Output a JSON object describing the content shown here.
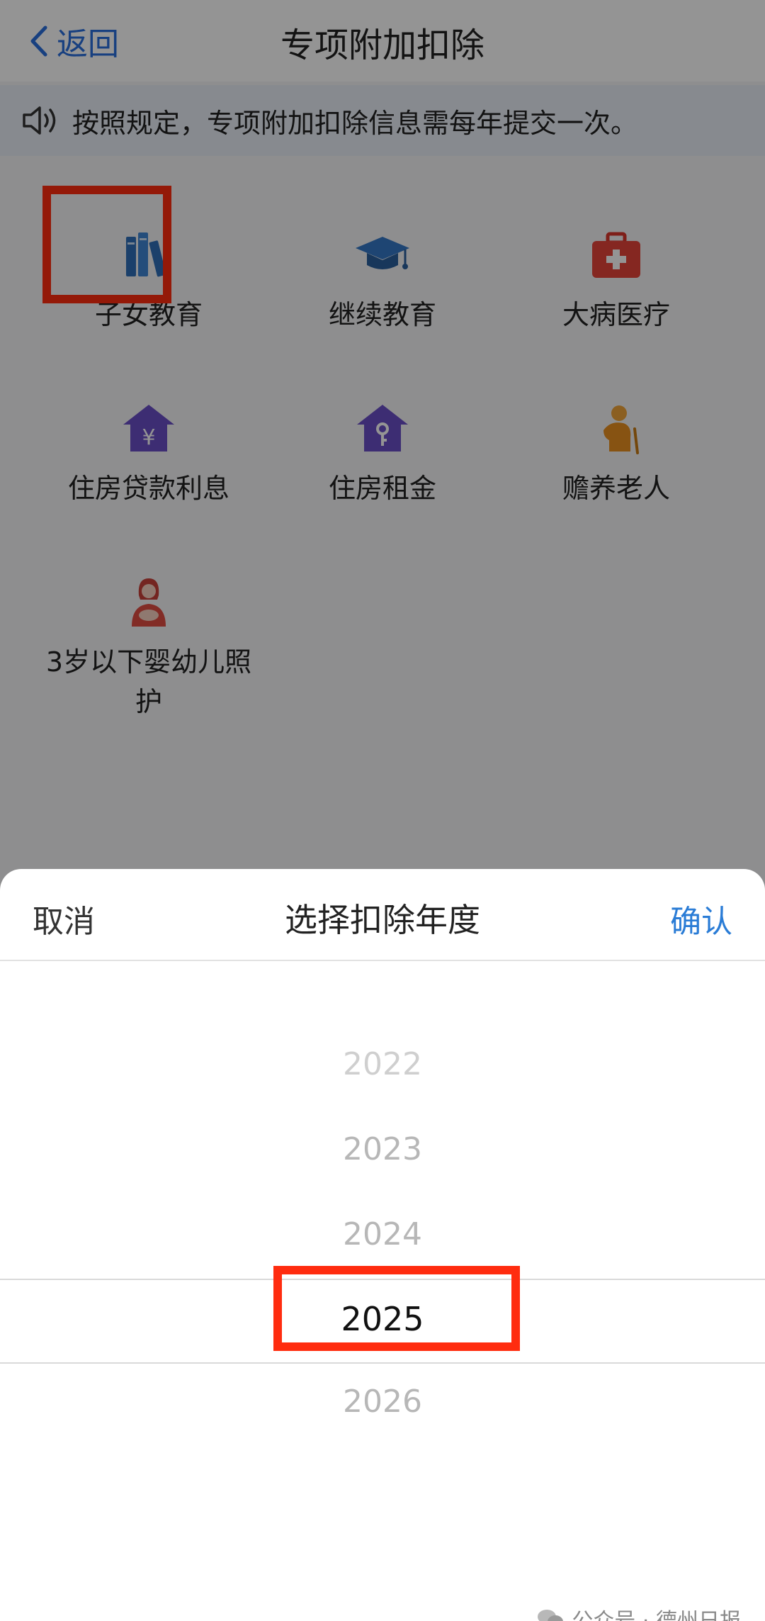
{
  "header": {
    "back_label": "返回",
    "title": "专项附加扣除"
  },
  "notice": {
    "text": "按照规定，专项附加扣除信息需每年提交一次。"
  },
  "categories": [
    {
      "label": "子女教育",
      "icon": "books-icon"
    },
    {
      "label": "继续教育",
      "icon": "graduation-cap-icon"
    },
    {
      "label": "大病医疗",
      "icon": "medical-kit-icon"
    },
    {
      "label": "住房贷款利息",
      "icon": "house-yuan-icon"
    },
    {
      "label": "住房租金",
      "icon": "house-key-icon"
    },
    {
      "label": "赡养老人",
      "icon": "elderly-person-icon"
    },
    {
      "label_line1": "3岁以下婴幼儿照",
      "label_line2": "护",
      "icon": "mother-baby-icon"
    }
  ],
  "picker": {
    "cancel": "取消",
    "title": "选择扣除年度",
    "confirm": "确认",
    "years": [
      "2022",
      "2023",
      "2024",
      "2025",
      "2026"
    ],
    "selected": "2025"
  },
  "watermark": {
    "text": "公众号 · 德州日报"
  },
  "colors": {
    "accent": "#2a7cd6",
    "highlight": "#ff2c0f"
  }
}
